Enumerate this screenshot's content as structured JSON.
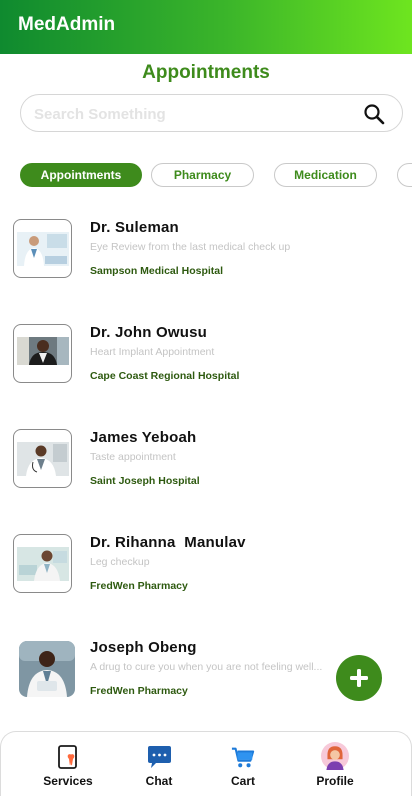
{
  "app_bar": {
    "title": "MedAdmin"
  },
  "page": {
    "title": "Appointments"
  },
  "search": {
    "placeholder": "Search Something"
  },
  "filters": [
    {
      "label": "Appointments",
      "active": true
    },
    {
      "label": "Pharmacy",
      "active": false
    },
    {
      "label": "Medication",
      "active": false
    },
    {
      "label": "",
      "active": false
    }
  ],
  "appointments": [
    {
      "name": "Dr. Suleman",
      "description": "Eye Review from the last medical check up",
      "place": "Sampson Medical Hospital",
      "avatar": "doctor-photo"
    },
    {
      "name": "Dr. John Owusu",
      "description": "Heart Implant Appointment",
      "place": "Cape Coast Regional Hospital",
      "avatar": "doctor-photo"
    },
    {
      "name": "James Yeboah",
      "description": "Taste appointment",
      "place": "Saint Joseph Hospital",
      "avatar": "doctor-photo"
    },
    {
      "name": "Dr. Rihanna  Manulav",
      "description": "Leg checkup",
      "place": "FredWen Pharmacy",
      "avatar": "doctor-photo"
    },
    {
      "name": "Joseph Obeng",
      "description": "A drug to cure you when you are not feeling well...",
      "place": "FredWen Pharmacy",
      "avatar": "doctor-photo"
    }
  ],
  "fab": {
    "icon": "plus-icon"
  },
  "bottom_nav": [
    {
      "label": "Services",
      "icon": "services-icon"
    },
    {
      "label": "Chat",
      "icon": "chat-icon"
    },
    {
      "label": "Cart",
      "icon": "cart-icon"
    },
    {
      "label": "Profile",
      "icon": "profile-avatar-icon"
    }
  ],
  "colors": {
    "primary": "#3e8b1c",
    "appbar_start": "#0f8a2f",
    "appbar_end": "#6ee51f"
  }
}
